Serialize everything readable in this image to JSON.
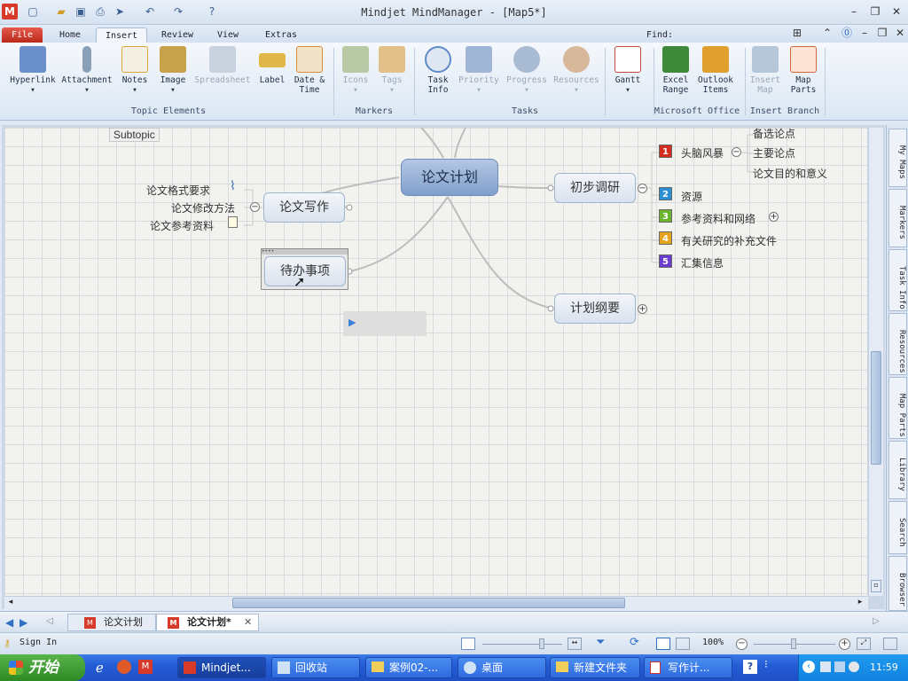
{
  "window": {
    "title": "Mindjet MindManager - [Map5*]"
  },
  "ribbon_tabs": [
    "File",
    "Home",
    "Insert",
    "Review",
    "View",
    "Extras"
  ],
  "find": {
    "label": "Find:",
    "value": ""
  },
  "ribbon": {
    "buttons": [
      {
        "label": "Hyperlink",
        "label2": "",
        "disabled": false,
        "color": "#6b8fc9"
      },
      {
        "label": "Attachment",
        "label2": "",
        "disabled": false,
        "color": "#8aa0b8"
      },
      {
        "label": "Notes",
        "label2": "",
        "disabled": false,
        "color": "#d9a63c"
      },
      {
        "label": "Image",
        "label2": "",
        "disabled": false,
        "color": "#c8a24a"
      },
      {
        "label": "Spreadsheet",
        "label2": "",
        "disabled": true,
        "color": "#c9d3df"
      },
      {
        "label": "Label",
        "label2": "",
        "disabled": false,
        "color": "#e0b84a"
      },
      {
        "label": "Date &",
        "label2": "Time",
        "disabled": false,
        "color": "#d88c3c"
      },
      {
        "label": "Icons",
        "label2": "",
        "disabled": true,
        "color": "#b9c9a6"
      },
      {
        "label": "Tags",
        "label2": "",
        "disabled": true,
        "color": "#e2c08a"
      },
      {
        "label": "Task",
        "label2": "Info",
        "disabled": false,
        "color": "#5f8bc7"
      },
      {
        "label": "Priority",
        "label2": "",
        "disabled": true,
        "color": "#9fb6d6"
      },
      {
        "label": "Progress",
        "label2": "",
        "disabled": true,
        "color": "#a9bbd3"
      },
      {
        "label": "Resources",
        "label2": "",
        "disabled": true,
        "color": "#d8b89a"
      },
      {
        "label": "Gantt",
        "label2": "",
        "disabled": false,
        "color": "#c64c3c"
      },
      {
        "label": "Excel",
        "label2": "Range",
        "disabled": false,
        "color": "#3f8a3a"
      },
      {
        "label": "Outlook",
        "label2": "Items",
        "disabled": false,
        "color": "#e0a030"
      },
      {
        "label": "Insert",
        "label2": "Map",
        "disabled": true,
        "color": "#b7c7da"
      },
      {
        "label": "Map",
        "label2": "Parts",
        "disabled": false,
        "color": "#d0663c"
      }
    ],
    "groups": [
      "Topic Elements",
      "Markers",
      "Tasks",
      "Microsoft Office",
      "Insert Branch"
    ]
  },
  "map": {
    "floating": "Subtopic",
    "central": "论文计划",
    "left_topics": [
      {
        "label": "论文写作",
        "subs": [
          "论文格式要求",
          "论文修改方法",
          "论文参考资料"
        ]
      },
      {
        "label": "待办事项",
        "subs": []
      }
    ],
    "right_topics": [
      {
        "label": "初步调研",
        "subs": [
          {
            "num": "1",
            "color": "#d62b1f",
            "label": "头脑风暴",
            "children": [
              "备选论点",
              "主要论点",
              "论文目的和意义"
            ]
          },
          {
            "num": "2",
            "color": "#2b8fd6",
            "label": "资源"
          },
          {
            "num": "3",
            "color": "#6bb52e",
            "label": "参考资料和网络"
          },
          {
            "num": "4",
            "color": "#e6a41e",
            "label": "有关研究的补充文件"
          },
          {
            "num": "5",
            "color": "#6a3ccf",
            "label": "汇集信息"
          }
        ]
      },
      {
        "label": "计划纲要",
        "subs": []
      }
    ]
  },
  "side_panel": [
    "My Maps",
    "Markers",
    "Task Info",
    "Resources",
    "Map Parts",
    "Library",
    "Search",
    "Browser"
  ],
  "doc_tabs": [
    "论文计划",
    "论文计划*"
  ],
  "status": {
    "sign_in": "Sign In",
    "zoom": "100%"
  },
  "taskbar": {
    "start": "开始",
    "tasks": [
      "Mindjet...",
      "回收站",
      "案例02-...",
      "桌面",
      "新建文件夹",
      "写作计..."
    ],
    "clock": "11:59"
  }
}
